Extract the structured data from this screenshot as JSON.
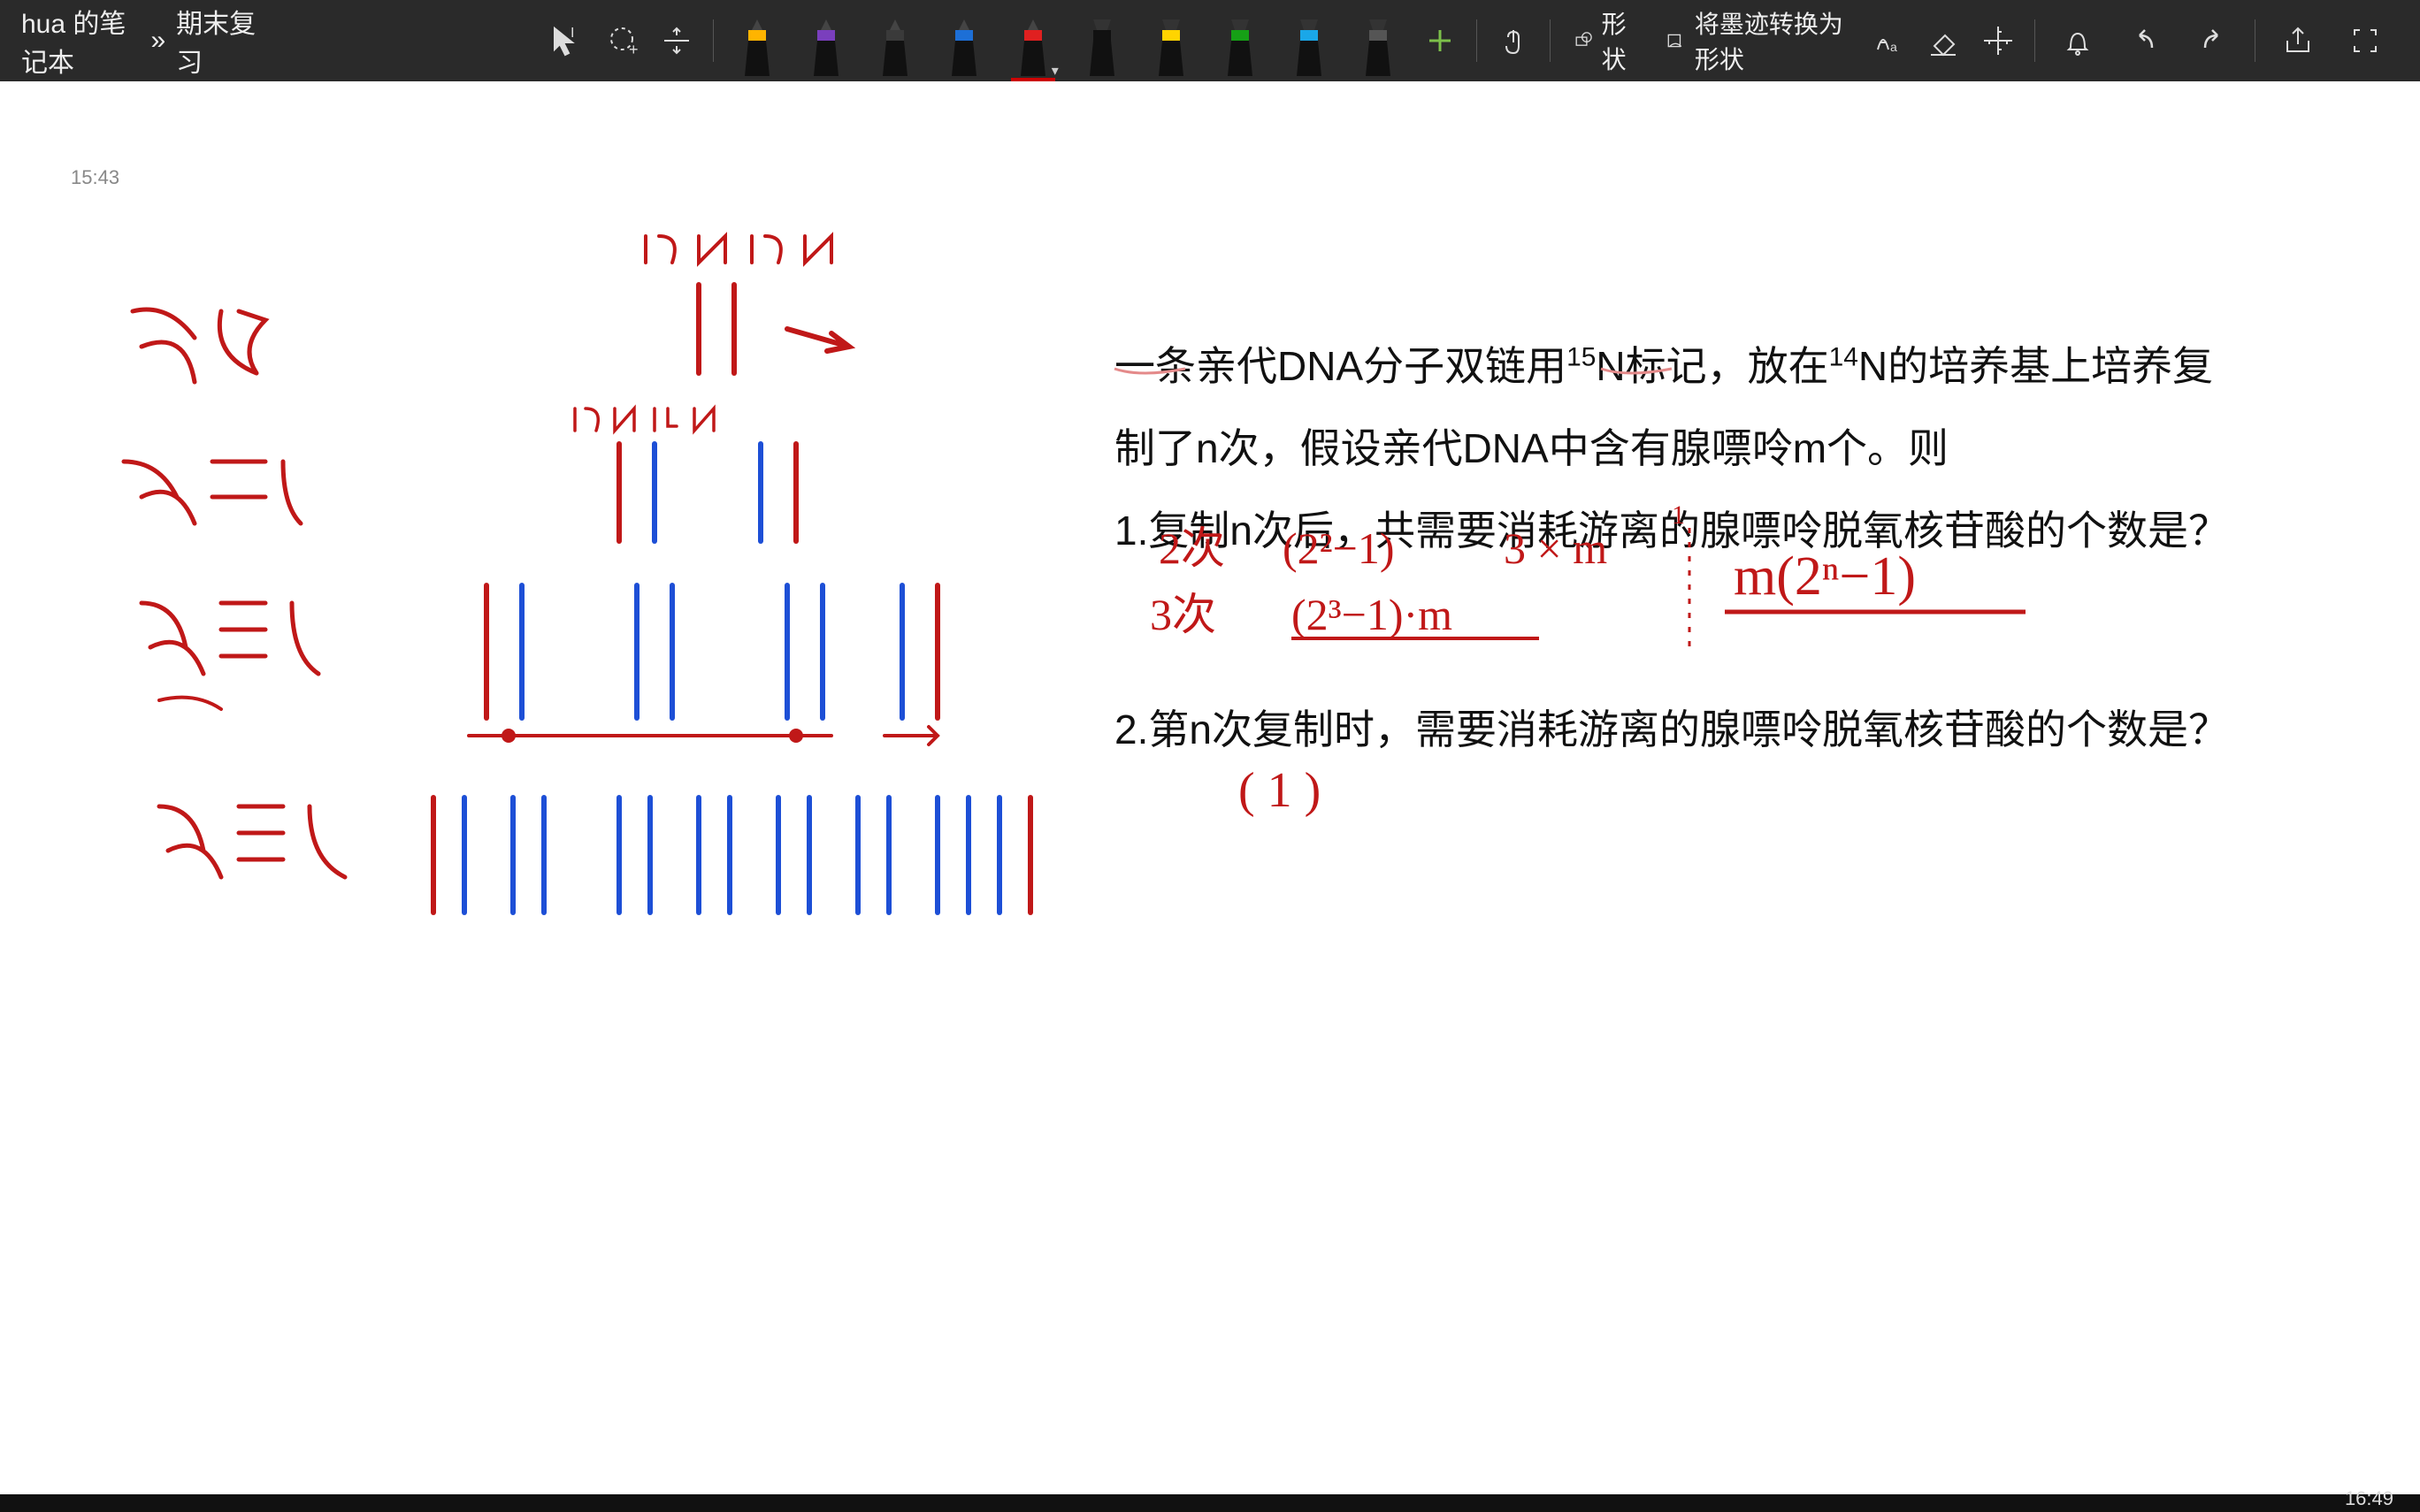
{
  "breadcrumb": {
    "notebook": "hua 的笔记本",
    "sep": "»",
    "page": "期末复习"
  },
  "toolbar": {
    "shape_label": "形状",
    "ink_to_shape_label": "将墨迹转换为形状"
  },
  "pens": [
    {
      "band": "#ffb400",
      "body": "#111",
      "type": "marker"
    },
    {
      "band": "#7a3fbd",
      "body": "#111",
      "type": "marker"
    },
    {
      "band": "#3a3a3a",
      "body": "#111",
      "type": "marker"
    },
    {
      "band": "#1d6fd6",
      "body": "#111",
      "type": "marker"
    },
    {
      "band": "#e02020",
      "body": "#111",
      "type": "marker",
      "selected": true
    },
    {
      "band": "#111",
      "body": "#111",
      "type": "hl"
    },
    {
      "band": "#ffd400",
      "body": "#111",
      "type": "hl"
    },
    {
      "band": "#16a016",
      "body": "#111",
      "type": "hl"
    },
    {
      "band": "#1aa7e8",
      "body": "#111",
      "type": "hl"
    },
    {
      "band": "#555",
      "body": "#111",
      "type": "hl"
    }
  ],
  "canvas": {
    "timestamp": "15:43",
    "problem": {
      "line1_a": "一条亲代DNA分子双链用",
      "line1_sup1": "15",
      "line1_b": "N标记，放在",
      "line1_sup2": "14",
      "line1_c": "N的培养基上培养复",
      "line2": "制了n次，假设亲代DNA中含有腺嘌呤m个。则",
      "q1": "1.复制n次后，共需要消耗游离的腺嘌呤脱氧核苷酸的个数是？",
      "q2": "2.第n次复制时，需要消耗游离的腺嘌呤脱氧核苷酸的个数是？"
    },
    "red_labels": {
      "gen0": "亲代",
      "gen1": "第一代",
      "gen2": "第二代",
      "gen3": "第三代",
      "n15": "15N",
      "n14": "14N",
      "work1a": "(2²−1)",
      "work1b": "3 × m",
      "work1c": "3次",
      "work1d": "(2³−1)·m",
      "answer1": "m(2ⁿ−1)",
      "work2": "(1)"
    }
  },
  "taskbar": {
    "clock": "16:49"
  }
}
